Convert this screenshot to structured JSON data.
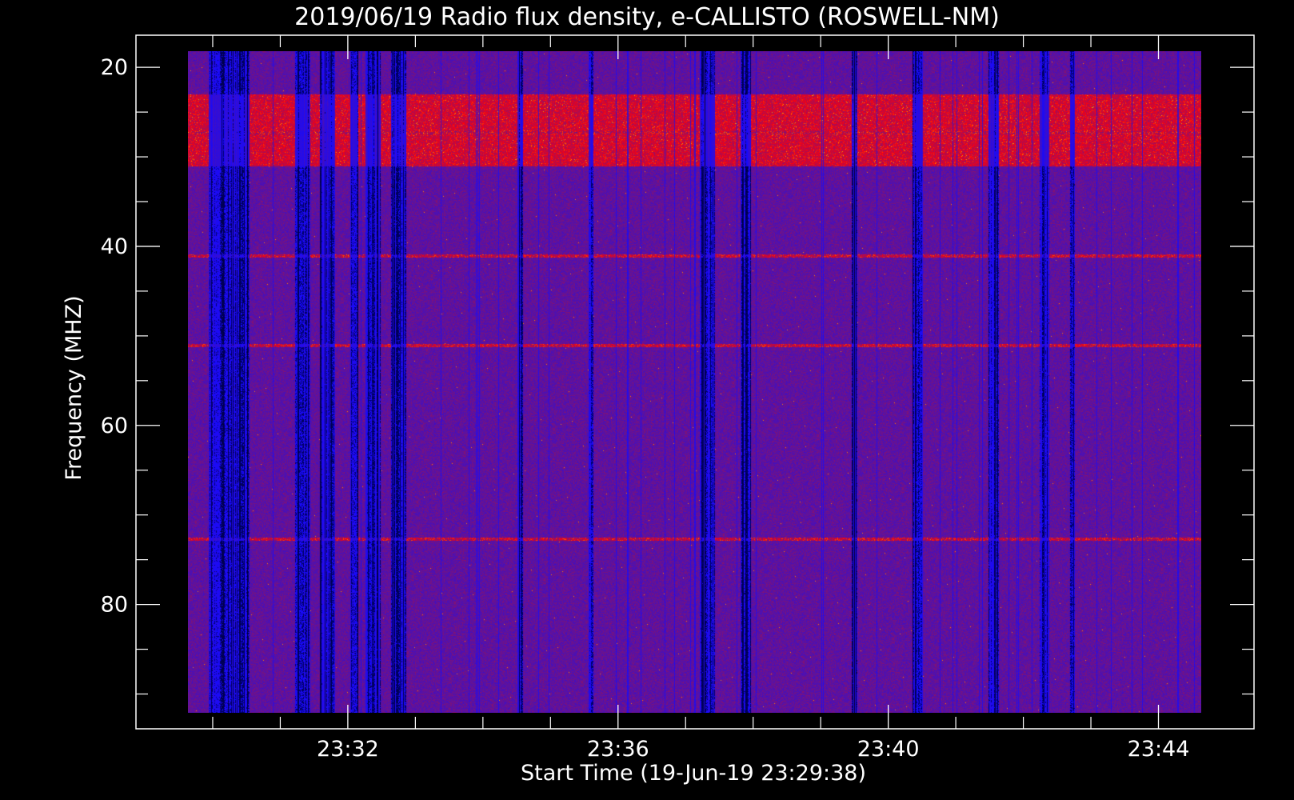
{
  "chart_data": {
    "type": "heatmap",
    "title": "2019/06/19  Radio flux density, e-CALLISTO (ROSWELL-NM)",
    "xlabel": "Start Time (19-Jun-19 23:29:38)",
    "ylabel": "Frequency (MHZ)",
    "x_ticks": [
      "23:32",
      "23:36",
      "23:40",
      "23:44"
    ],
    "y_ticks": [
      "20",
      "40",
      "60",
      "80"
    ],
    "x_range": [
      "23:29:38",
      "23:44:38"
    ],
    "y_range_mhz": [
      18.2,
      92.1
    ],
    "y_data_range_mhz": [
      20,
      92
    ],
    "y_direction": "descending",
    "colormap": [
      "#000000",
      "#1010ff",
      "#2a1ad8",
      "#6a1a90",
      "#c01010",
      "#ff2010",
      "#ffd000"
    ],
    "features": [
      {
        "name": "strong emission band",
        "freq_mhz": [
          23,
          31
        ]
      },
      {
        "name": "narrowband line",
        "freq_mhz": [
          27.3,
          27.3
        ]
      },
      {
        "name": "narrowband line",
        "freq_mhz": [
          41,
          41
        ]
      },
      {
        "name": "narrowband line",
        "freq_mhz": [
          51,
          51
        ]
      },
      {
        "name": "narrowband line",
        "freq_mhz": [
          72.7,
          72.7
        ]
      }
    ],
    "grid": false
  },
  "colors": {
    "background": "#000000",
    "axes": "#ffffff",
    "low_intensity": "#1a1aff",
    "mid_intensity": "#7a1a80",
    "high_intensity": "#ff2000",
    "peak_intensity": "#ffe000"
  }
}
